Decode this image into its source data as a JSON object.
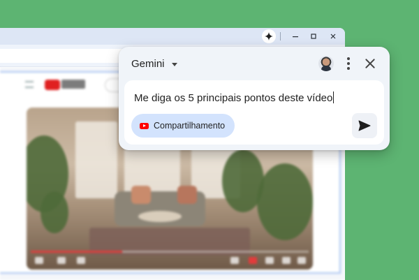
{
  "browser": {
    "icons": {
      "gemini": "gemini-sparkle-icon",
      "minimize": "minimize-icon",
      "maximize": "maximize-icon",
      "close": "close-icon"
    },
    "video": {
      "progress": 0.33
    }
  },
  "gemini": {
    "title": "Gemini",
    "prompt_value": "Me diga os 5 principais pontos deste vídeo",
    "share_chip_label": "Compartilhamento",
    "icons": {
      "dropdown": "chevron-down-icon",
      "avatar": "user-avatar",
      "more": "more-vert-icon",
      "close": "close-icon",
      "share": "youtube-icon",
      "send": "send-icon"
    }
  },
  "colors": {
    "background": "#5db472",
    "panel": "#f0f4f9",
    "chip": "#d3e3fd",
    "youtube_red": "#ff0000"
  }
}
